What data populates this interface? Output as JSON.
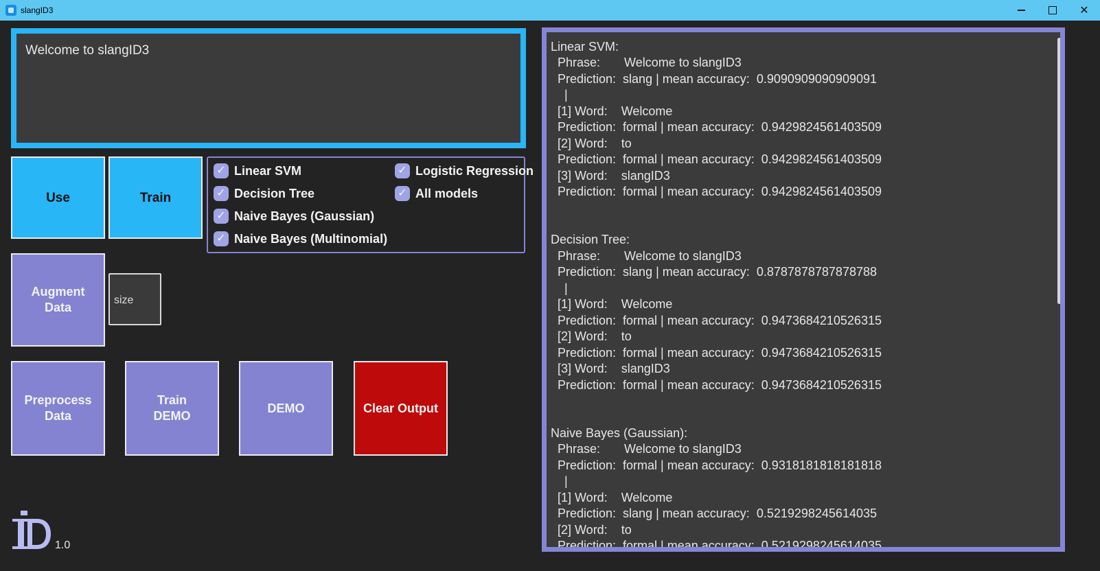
{
  "window": {
    "title": "slangID3"
  },
  "input": {
    "text": "Welcome to slangID3"
  },
  "buttons": {
    "use": "Use",
    "train": "Train",
    "augment_line1": "Augment",
    "augment_line2": "Data",
    "preprocess_line1": "Preprocess",
    "preprocess_line2": "Data",
    "train_demo_line1": "Train",
    "train_demo_line2": "DEMO",
    "demo": "DEMO",
    "clear_output": "Clear Output"
  },
  "models": [
    {
      "label": "Linear SVM",
      "checked": true
    },
    {
      "label": "Decision Tree",
      "checked": true
    },
    {
      "label": "Naive Bayes (Gaussian)",
      "checked": true
    },
    {
      "label": "Naive Bayes (Multinomial)",
      "checked": true
    },
    {
      "label": "Logistic Regression",
      "checked": true
    },
    {
      "label": "All models",
      "checked": true
    }
  ],
  "size_field": {
    "placeholder": "size"
  },
  "version": "1.0",
  "colors": {
    "accent_blue": "#29b6f6",
    "accent_purple": "#8383d2",
    "danger_red": "#be0a0a",
    "background": "#232323"
  },
  "output": {
    "text": "Linear SVM:\n  Phrase:       Welcome to slangID3\n  Prediction:  slang | mean accuracy:  0.9090909090909091\n    |\n  [1] Word:    Welcome\n  Prediction:  formal | mean accuracy:  0.9429824561403509\n  [2] Word:    to\n  Prediction:  formal | mean accuracy:  0.9429824561403509\n  [3] Word:    slangID3\n  Prediction:  formal | mean accuracy:  0.9429824561403509\n\n\nDecision Tree:\n  Phrase:       Welcome to slangID3\n  Prediction:  slang | mean accuracy:  0.8787878787878788\n    |\n  [1] Word:    Welcome\n  Prediction:  formal | mean accuracy:  0.9473684210526315\n  [2] Word:    to\n  Prediction:  formal | mean accuracy:  0.9473684210526315\n  [3] Word:    slangID3\n  Prediction:  formal | mean accuracy:  0.9473684210526315\n\n\nNaive Bayes (Gaussian):\n  Phrase:       Welcome to slangID3\n  Prediction:  formal | mean accuracy:  0.9318181818181818\n    |\n  [1] Word:    Welcome\n  Prediction:  slang | mean accuracy:  0.5219298245614035\n  [2] Word:    to\n  Prediction:  formal | mean accuracy:  0.5219298245614035"
  }
}
